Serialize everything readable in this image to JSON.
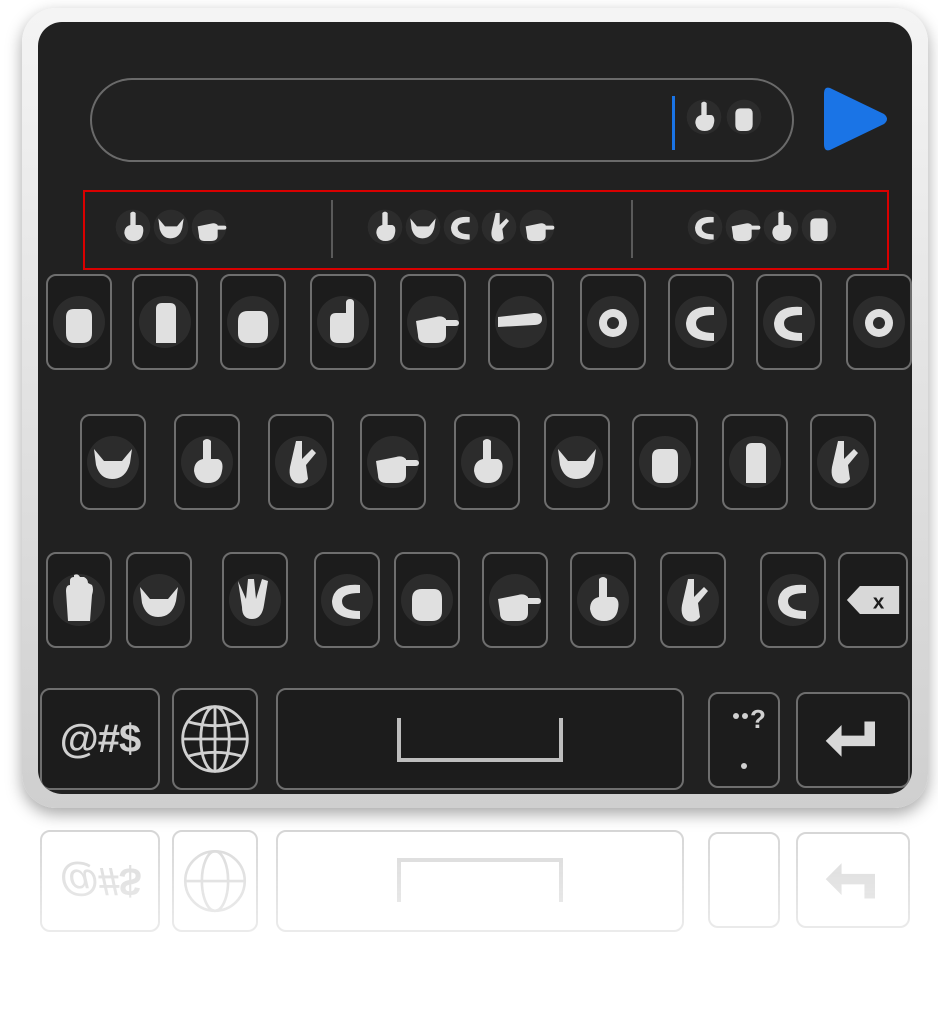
{
  "input": {
    "typed_glyphs": [
      "sign-index-up-icon",
      "sign-fist-icon"
    ]
  },
  "send_icon": "play-arrow-icon",
  "accent_color": "#1a74e6",
  "suggestion_highlight_color": "#d90000",
  "suggestions": [
    {
      "glyphs": [
        "sign-index-up-icon",
        "sign-y-icon",
        "sign-point-icon"
      ]
    },
    {
      "glyphs": [
        "sign-index-up-icon",
        "sign-y-icon",
        "sign-c-icon",
        "sign-k-icon",
        "sign-point-icon"
      ]
    },
    {
      "glyphs": [
        "sign-c-icon",
        "sign-point-icon",
        "sign-index-up-icon",
        "sign-fist-icon"
      ]
    }
  ],
  "rows": [
    [
      "sign-fist-icon",
      "sign-b-icon",
      "sign-e-icon",
      "sign-thumb-icon",
      "sign-point-icon",
      "sign-flat-icon",
      "sign-o-icon",
      "sign-c-icon",
      "sign-c-icon",
      "sign-o-icon"
    ],
    [
      "sign-y-icon",
      "sign-index-up-icon",
      "sign-k-icon",
      "sign-point-icon",
      "sign-index-up-icon",
      "sign-y-icon",
      "sign-fist-icon",
      "sign-b-icon",
      "sign-k-icon"
    ],
    [
      "sign-open-palm-icon",
      "sign-y-icon",
      "sign-w-icon",
      "sign-c-icon",
      "sign-e-icon",
      "sign-point-icon",
      "sign-index-up-icon",
      "sign-k-icon",
      "sign-c-icon"
    ]
  ],
  "function_keys": {
    "symbols_label": "@#$",
    "globe_icon": "globe-icon",
    "space_icon": "space-bar-icon",
    "punctuation_label": "‥?\n.",
    "enter_icon": "enter-arrow-icon",
    "backspace_icon": "backspace-icon",
    "backspace_label": "x"
  }
}
